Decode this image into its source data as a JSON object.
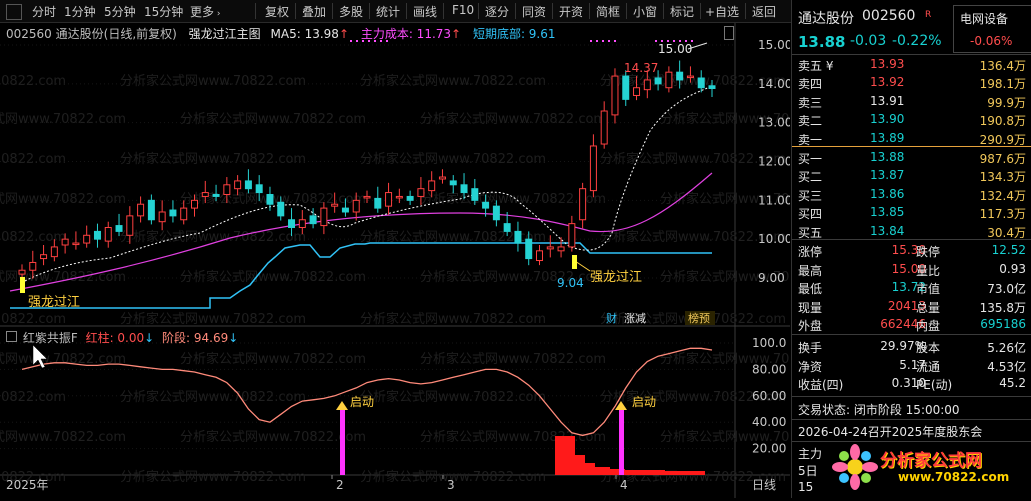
{
  "toolbar": {
    "items": [
      "分时",
      "1分钟",
      "5分钟",
      "15分钟",
      "更多",
      "复权",
      "叠加",
      "多股",
      "统计",
      "画线",
      "F10",
      "逐分",
      "同资",
      "开资",
      "简框",
      "小窗",
      "标记",
      "+自选",
      "返回"
    ]
  },
  "chart_info": {
    "code": "002560",
    "name": "通达股份",
    "mode": "(日线,前复权)",
    "indicator": "强龙过江主图",
    "ma5": "MA5: 13.98",
    "cost": "主力成本: 11.73",
    "bottom": "短期底部: 9.61"
  },
  "sub_info": {
    "name": "红紫共振F",
    "hongzhu": "红柱: 0.00",
    "jieduan": "阶段: 94.69"
  },
  "price_axis": [
    "15.00",
    "14.00",
    "13.00",
    "12.00",
    "11.00",
    "10.00",
    "9.00"
  ],
  "osc_axis": [
    "100.0",
    "80.00",
    "60.00",
    "40.00",
    "20.00"
  ],
  "time_axis": [
    "2025年",
    "2",
    "3",
    "4"
  ],
  "time_mode": "日线",
  "chart_labels": {
    "high": "15.00",
    "peak": "14.37",
    "low": "9.04",
    "signal1": "强龙过江",
    "signal2": "强龙过江",
    "start1": "启动",
    "start2": "启动",
    "tags": [
      "财",
      "涨减",
      "榜预"
    ]
  },
  "panel": {
    "name": "通达股份",
    "code": "002560",
    "badge": "R",
    "price": "13.88",
    "change": "-0.03",
    "pct": "-0.22%",
    "sector": "电网设备",
    "sector_pct": "-0.06%",
    "asks": [
      {
        "label": "卖五 ¥",
        "price": "13.93",
        "vol": "136.4万"
      },
      {
        "label": "卖四",
        "price": "13.92",
        "vol": "198.1万"
      },
      {
        "label": "卖三",
        "price": "13.91",
        "vol": "99.9万"
      },
      {
        "label": "卖二",
        "price": "13.90",
        "vol": "190.8万"
      },
      {
        "label": "卖一",
        "price": "13.89",
        "vol": "290.9万"
      }
    ],
    "bids": [
      {
        "label": "买一",
        "price": "13.88",
        "vol": "987.6万"
      },
      {
        "label": "买二",
        "price": "13.87",
        "vol": "134.3万"
      },
      {
        "label": "买三",
        "price": "13.86",
        "vol": "132.4万"
      },
      {
        "label": "买四",
        "price": "13.85",
        "vol": "117.3万"
      },
      {
        "label": "买五",
        "price": "13.84",
        "vol": "30.4万"
      }
    ],
    "stats": [
      {
        "l1": "涨停",
        "v1": "15.30",
        "l2": "跌停",
        "v2": "12.52"
      },
      {
        "l1": "最高",
        "v1": "15.00",
        "l2": "量比",
        "v2": "0.93"
      },
      {
        "l1": "最低",
        "v1": "13.72",
        "l2": "市值",
        "v2": "73.0亿"
      },
      {
        "l1": "现量",
        "v1": "20413",
        "l2": "总量",
        "v2": "135.8万"
      },
      {
        "l1": "外盘",
        "v1": "662446",
        "l2": "内盘",
        "v2": "695186"
      }
    ],
    "stats2": [
      {
        "l1": "换手",
        "v1": "29.97%",
        "l2": "股本",
        "v2": "5.26亿"
      },
      {
        "l1": "净资",
        "v1": "5.17",
        "l2": "流通",
        "v2": "4.53亿"
      },
      {
        "l1": "收益(四)",
        "v1": "0.310",
        "l2": "PE(动)",
        "v2": "45.2"
      }
    ],
    "trade_status": "交易状态: 闭市阶段 15:00:00",
    "notice": "2026-04-24召开2025年度股东会",
    "misc1": "主力",
    "misc2": "5日",
    "misc3": "15",
    "logo_text": "分析家公式网",
    "logo_url": "www.70822.com"
  },
  "watermark": "分析家公式网www.70822.com",
  "chart_data": {
    "type": "candlestick",
    "price_range": [
      8.6,
      15.3
    ],
    "close": [
      9.2,
      9.4,
      9.6,
      9.8,
      10.0,
      9.9,
      10.1,
      10.0,
      10.3,
      10.2,
      10.6,
      10.9,
      10.5,
      10.7,
      10.6,
      10.8,
      11.0,
      11.2,
      11.1,
      11.4,
      11.5,
      11.3,
      11.2,
      10.9,
      10.6,
      10.3,
      10.5,
      10.4,
      10.8,
      10.9,
      10.7,
      11.0,
      11.1,
      10.8,
      11.2,
      11.1,
      11.0,
      11.3,
      11.5,
      11.6,
      11.4,
      11.2,
      11.0,
      10.8,
      10.5,
      10.2,
      9.9,
      9.5,
      9.7,
      9.8,
      9.8,
      10.4,
      11.3,
      12.4,
      13.3,
      14.2,
      13.6,
      13.9,
      14.1,
      14.0,
      14.3,
      14.1,
      14.2,
      13.9,
      13.88
    ],
    "oscillator": [
      80,
      82,
      84,
      85,
      85,
      84,
      83,
      83,
      84,
      84,
      83,
      82,
      81,
      80,
      80,
      79,
      78,
      76,
      74,
      70,
      62,
      50,
      42,
      40,
      46,
      52,
      56,
      57,
      58,
      60,
      63,
      66,
      70,
      72,
      73,
      72,
      70,
      69,
      70,
      72,
      74,
      76,
      78,
      80,
      80,
      78,
      74,
      68,
      60,
      50,
      40,
      32,
      30,
      32,
      40,
      52,
      66,
      78,
      86,
      90,
      92,
      94,
      96,
      96,
      94.69
    ]
  }
}
